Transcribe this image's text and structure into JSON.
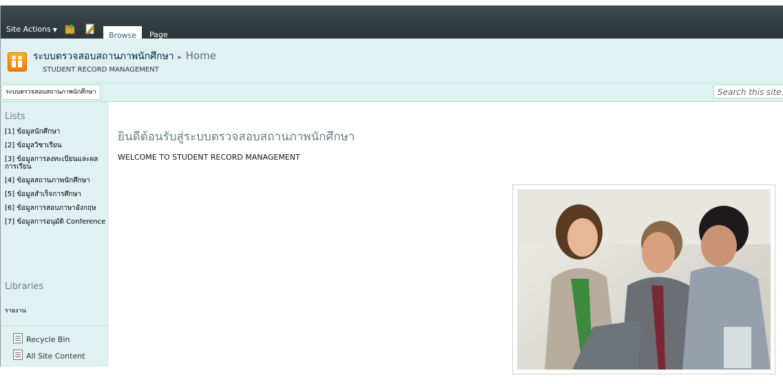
{
  "ribbon": {
    "site_actions": "Site Actions",
    "tabs": [
      "Browse",
      "Page"
    ]
  },
  "title_area": {
    "site_title": "ระบบตรวจสอบสถานภาพนักศึกษา",
    "breadcrumb_separator": "▸",
    "current_page": "Home",
    "description": "STUDENT RECORD MANAGEMENT"
  },
  "topnav": {
    "item": "ระบบตรวจสอบสถานภาพนักศึกษา",
    "search_placeholder": "Search this site..."
  },
  "leftnav": {
    "lists_heading": "Lists",
    "list_items": [
      "[1] ข้อมูลนักศึกษา",
      "[2] ข้อมูลวิชาเรียน",
      "[3] ข้อมูลการลงทะเบียนและผลการเรียน",
      "[4] ข้อมูลสถานภาพนักศึกษา",
      "[5] ข้อมูลสำเร็จการศึกษา",
      "[6] ข้อมูลการสอบภาษาอังกฤษ",
      "[7] ข้อมูลการอนุมัติ Conference"
    ],
    "libraries_heading": "Libraries",
    "library_items": [
      "รายงาน"
    ],
    "recycle_bin": "Recycle Bin",
    "all_site_content": "All Site Content"
  },
  "main": {
    "welcome_thai": "ยินดีต้อนรับสู่ระบบตรวจสอบสถานภาพนักศึกษา",
    "welcome_english": "WELCOME TO STUDENT RECORD MANAGEMENT"
  },
  "colors": {
    "ribbon": "#2f393b",
    "titlebar": "#dff1f1",
    "heading_gray": "#6d7d83"
  }
}
